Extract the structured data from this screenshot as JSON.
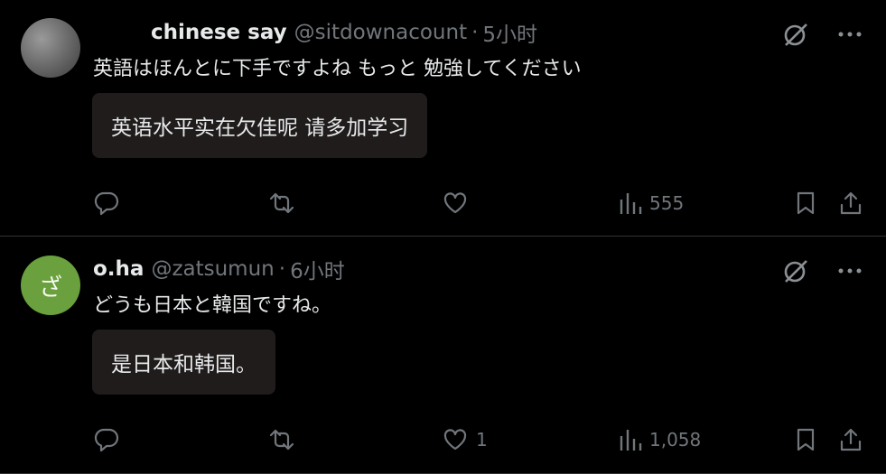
{
  "posts": [
    {
      "avatar_text": "",
      "display_name": "chinese say",
      "handle": "@sitdownacount",
      "separator": "·",
      "time": "5小时",
      "text": "英語はほんとに下手ですよね もっと 勉強してください",
      "translation": "英语水平实在欠佳呢 请多加学习",
      "reply_count": "",
      "repost_count": "",
      "like_count": "",
      "view_count": "555"
    },
    {
      "avatar_text": "ざ",
      "display_name": "o.ha",
      "handle": "@zatsumun",
      "separator": "·",
      "time": "6小时",
      "text": "どうも日本と韓国ですね。",
      "translation": "是日本和韩国。",
      "reply_count": "",
      "repost_count": "",
      "like_count": "1",
      "view_count": "1,058"
    }
  ],
  "icons": {
    "grok": "grok-icon",
    "more": "more-icon",
    "reply": "reply-icon",
    "repost": "repost-icon",
    "like": "heart-icon",
    "views": "views-icon",
    "bookmark": "bookmark-icon",
    "share": "share-icon"
  },
  "colors": {
    "background": "#000000",
    "text": "#e7e9ea",
    "muted": "#71767b",
    "translation_bg": "#201c1c",
    "avatar2": "#6aa03d",
    "divider": "#2f3336"
  }
}
